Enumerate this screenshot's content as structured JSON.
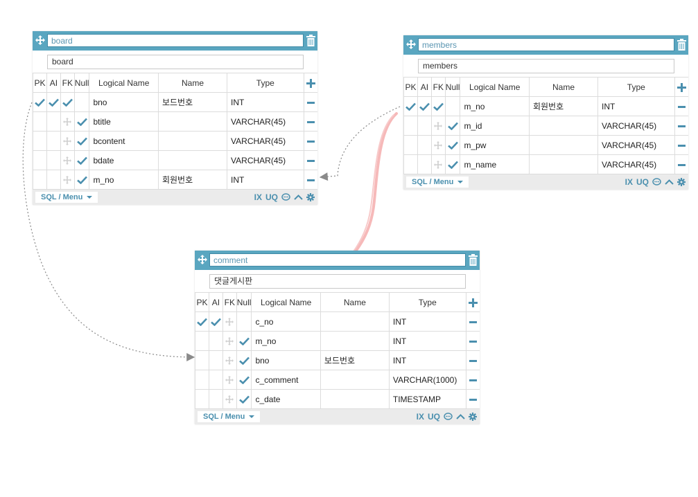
{
  "colors": {
    "accent": "#5aa6c0",
    "icon": "#4a8fae",
    "fk_arrow": "#888888",
    "sketch": "#f08a8a"
  },
  "tables": [
    {
      "id": "board",
      "name": "board",
      "comment": "board",
      "headers": {
        "pk": "PK",
        "ai": "AI",
        "fk": "FK",
        "null": "Null",
        "logical": "Logical Name",
        "name": "Name",
        "type": "Type"
      },
      "rows": [
        {
          "pk": true,
          "ai": true,
          "fk": "check",
          "null": false,
          "logical": "bno",
          "name": "보드번호",
          "type": "INT"
        },
        {
          "pk": false,
          "ai": false,
          "fk": "move",
          "null": true,
          "logical": "btitle",
          "name": "",
          "type": "VARCHAR(45)"
        },
        {
          "pk": false,
          "ai": false,
          "fk": "move",
          "null": true,
          "logical": "bcontent",
          "name": "",
          "type": "VARCHAR(45)"
        },
        {
          "pk": false,
          "ai": false,
          "fk": "move",
          "null": true,
          "logical": "bdate",
          "name": "",
          "type": "VARCHAR(45)"
        },
        {
          "pk": false,
          "ai": false,
          "fk": "move",
          "null": true,
          "logical": "m_no",
          "name": "회원번호",
          "type": "INT"
        }
      ],
      "footer": {
        "sql_menu": "SQL / Menu",
        "ix": "IX",
        "uq": "UQ"
      }
    },
    {
      "id": "members",
      "name": "members",
      "comment": "members",
      "headers": {
        "pk": "PK",
        "ai": "AI",
        "fk": "FK",
        "null": "Null",
        "logical": "Logical Name",
        "name": "Name",
        "type": "Type"
      },
      "rows": [
        {
          "pk": true,
          "ai": true,
          "fk": "check",
          "null": false,
          "logical": "m_no",
          "name": "회원번호",
          "type": "INT"
        },
        {
          "pk": false,
          "ai": false,
          "fk": "move",
          "null": true,
          "logical": "m_id",
          "name": "",
          "type": "VARCHAR(45)"
        },
        {
          "pk": false,
          "ai": false,
          "fk": "move",
          "null": true,
          "logical": "m_pw",
          "name": "",
          "type": "VARCHAR(45)"
        },
        {
          "pk": false,
          "ai": false,
          "fk": "move",
          "null": true,
          "logical": "m_name",
          "name": "",
          "type": "VARCHAR(45)"
        }
      ],
      "footer": {
        "sql_menu": "SQL / Menu",
        "ix": "IX",
        "uq": "UQ"
      }
    },
    {
      "id": "comment",
      "name": "comment",
      "comment": "댓글게시판",
      "headers": {
        "pk": "PK",
        "ai": "AI",
        "fk": "FK",
        "null": "Null",
        "logical": "Logical Name",
        "name": "Name",
        "type": "Type"
      },
      "rows": [
        {
          "pk": true,
          "ai": true,
          "fk": "move",
          "null": false,
          "logical": "c_no",
          "name": "",
          "type": "INT"
        },
        {
          "pk": false,
          "ai": false,
          "fk": "move",
          "null": true,
          "logical": "m_no",
          "name": "",
          "type": "INT"
        },
        {
          "pk": false,
          "ai": false,
          "fk": "move",
          "null": true,
          "logical": "bno",
          "name": "보드번호",
          "type": "INT"
        },
        {
          "pk": false,
          "ai": false,
          "fk": "move",
          "null": true,
          "logical": "c_comment",
          "name": "",
          "type": "VARCHAR(1000)"
        },
        {
          "pk": false,
          "ai": false,
          "fk": "move",
          "null": true,
          "logical": "c_date",
          "name": "",
          "type": "TIMESTAMP"
        }
      ],
      "footer": {
        "sql_menu": "SQL / Menu",
        "ix": "IX",
        "uq": "UQ"
      }
    }
  ],
  "relations": [
    {
      "from": "members.m_no",
      "to": "board.m_no",
      "style": "dashed-arrow"
    },
    {
      "from": "board.bno",
      "to": "comment.bno",
      "style": "dashed-arrow"
    },
    {
      "from": "members.m_no",
      "to": "comment.m_no",
      "style": "hand-drawn-red-arrow"
    }
  ]
}
